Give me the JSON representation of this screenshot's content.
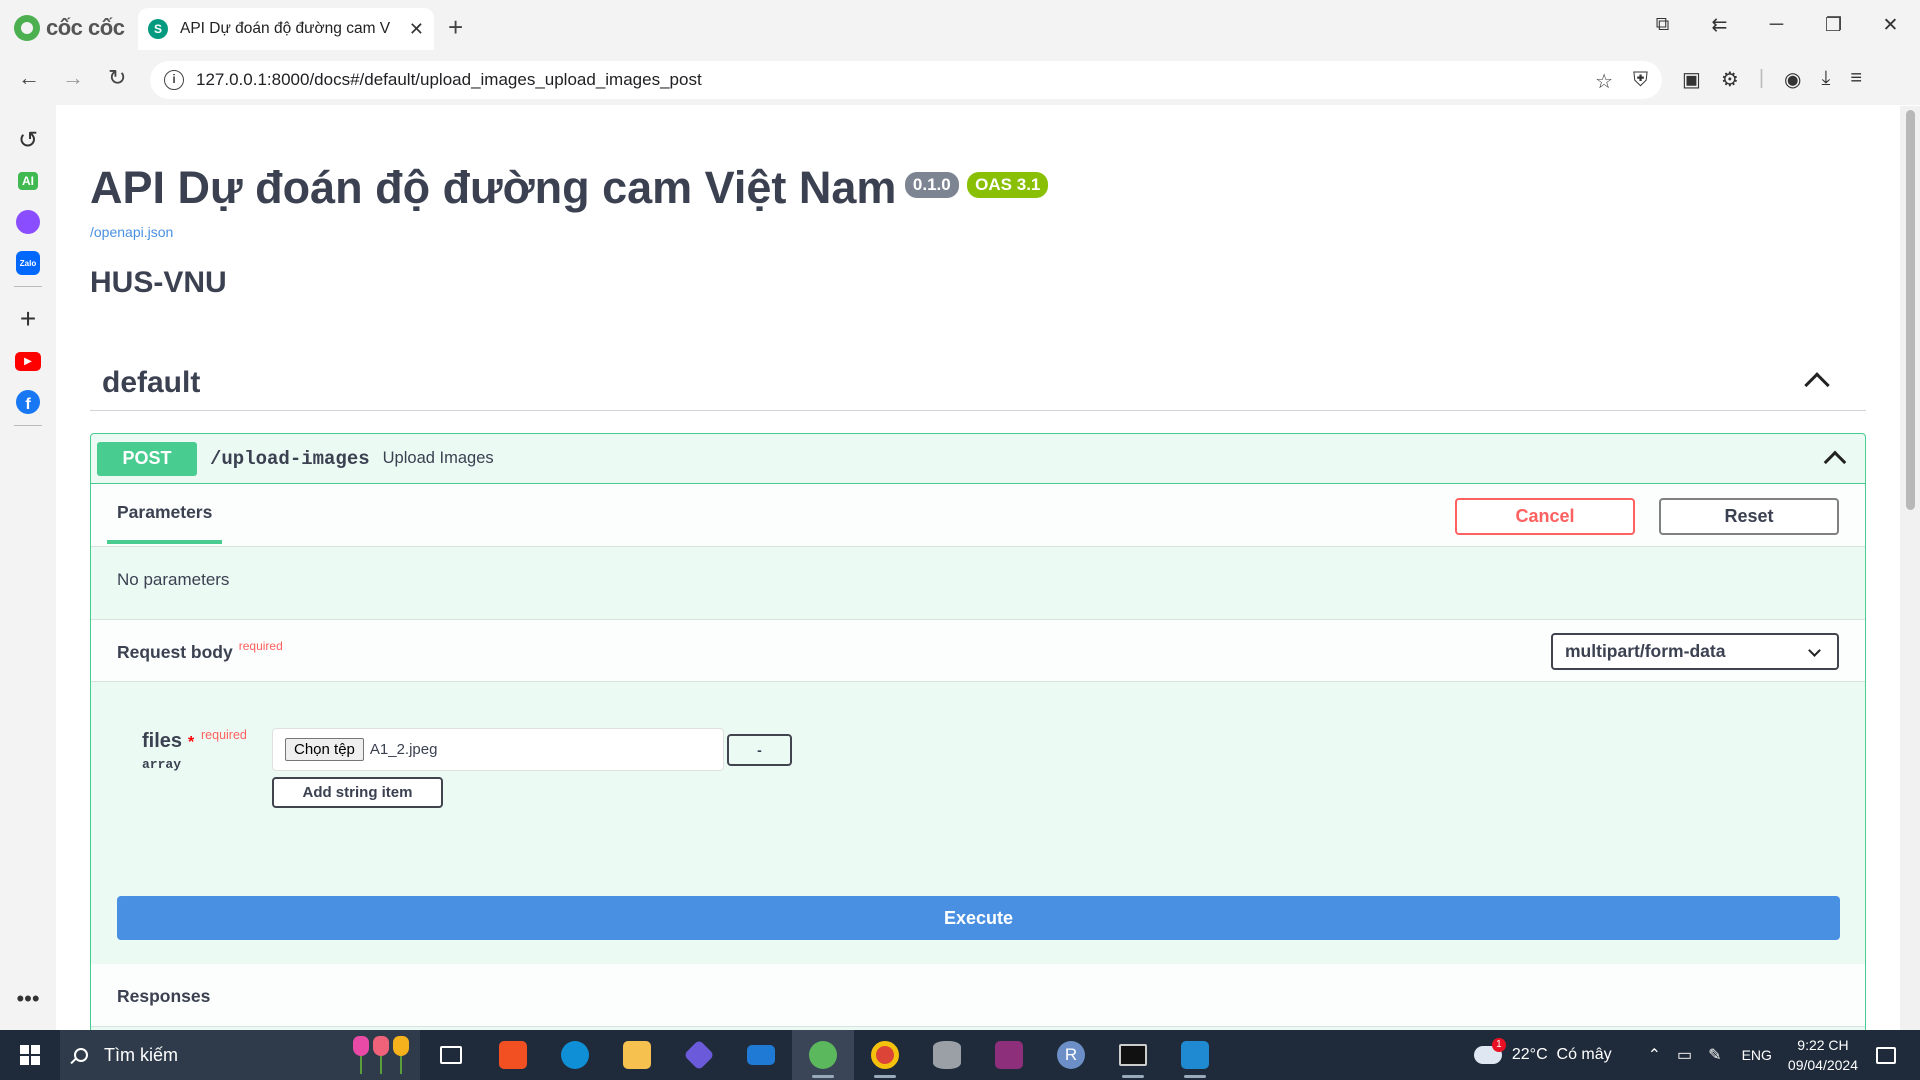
{
  "browser": {
    "logo_text": "cốc cốc",
    "tab_title": "API Dự đoán độ đường cam Việt Nam - Swagger UI",
    "tab_favicon": "swagger-icon",
    "url": "127.0.0.1:8000/docs#/default/upload_images_upload_images_post"
  },
  "sidebar": {
    "items": [
      "history-icon",
      "ai-icon",
      "messenger-icon",
      "zalo-icon",
      "add-icon",
      "youtube-icon",
      "facebook-icon",
      "more-icon"
    ],
    "ai_label": "AI",
    "zalo_label": "Zalo"
  },
  "info": {
    "title": "API Dự đoán độ đường cam Việt Nam",
    "version": "0.1.0",
    "oas": "OAS 3.1",
    "spec_link": "/openapi.json",
    "description": "HUS-VNU"
  },
  "tag": {
    "name": "default"
  },
  "operation": {
    "method": "POST",
    "path": "/upload-images",
    "summary": "Upload Images",
    "parameters_tab": "Parameters",
    "cancel_label": "Cancel",
    "reset_label": "Reset",
    "no_params": "No parameters",
    "request_body_label": "Request body",
    "required_label": "required",
    "content_type": "multipart/form-data",
    "param": {
      "name": "files",
      "asterisk": "*",
      "required": "required",
      "type": "array",
      "file_button": "Chọn tệp",
      "file_name": "A1_2.jpeg",
      "remove_label": "-",
      "add_item_label": "Add string item"
    },
    "execute_label": "Execute",
    "responses_label": "Responses"
  },
  "taskbar": {
    "search_placeholder": "Tìm kiếm",
    "weather": "22°C  Có mây",
    "weather_badge": "1",
    "language": "ENG",
    "time": "9:22 CH",
    "date": "09/04/2024",
    "apps": [
      "task-view-icon",
      "microsoft-store-icon",
      "edge-icon",
      "file-explorer-icon",
      "copilot-icon",
      "mail-icon",
      "coccoc-icon",
      "chrome-icon",
      "database-icon",
      "winrar-icon",
      "r-icon",
      "terminal-icon",
      "vscode-icon"
    ]
  },
  "colors": {
    "post": "#49cc90",
    "post_bg": "#ecfaf4",
    "execute": "#4990e2",
    "cancel": "#ff6060",
    "version_badge": "#7d8492",
    "oas_badge": "#89bf04",
    "taskbar": "#1f2b3a"
  }
}
